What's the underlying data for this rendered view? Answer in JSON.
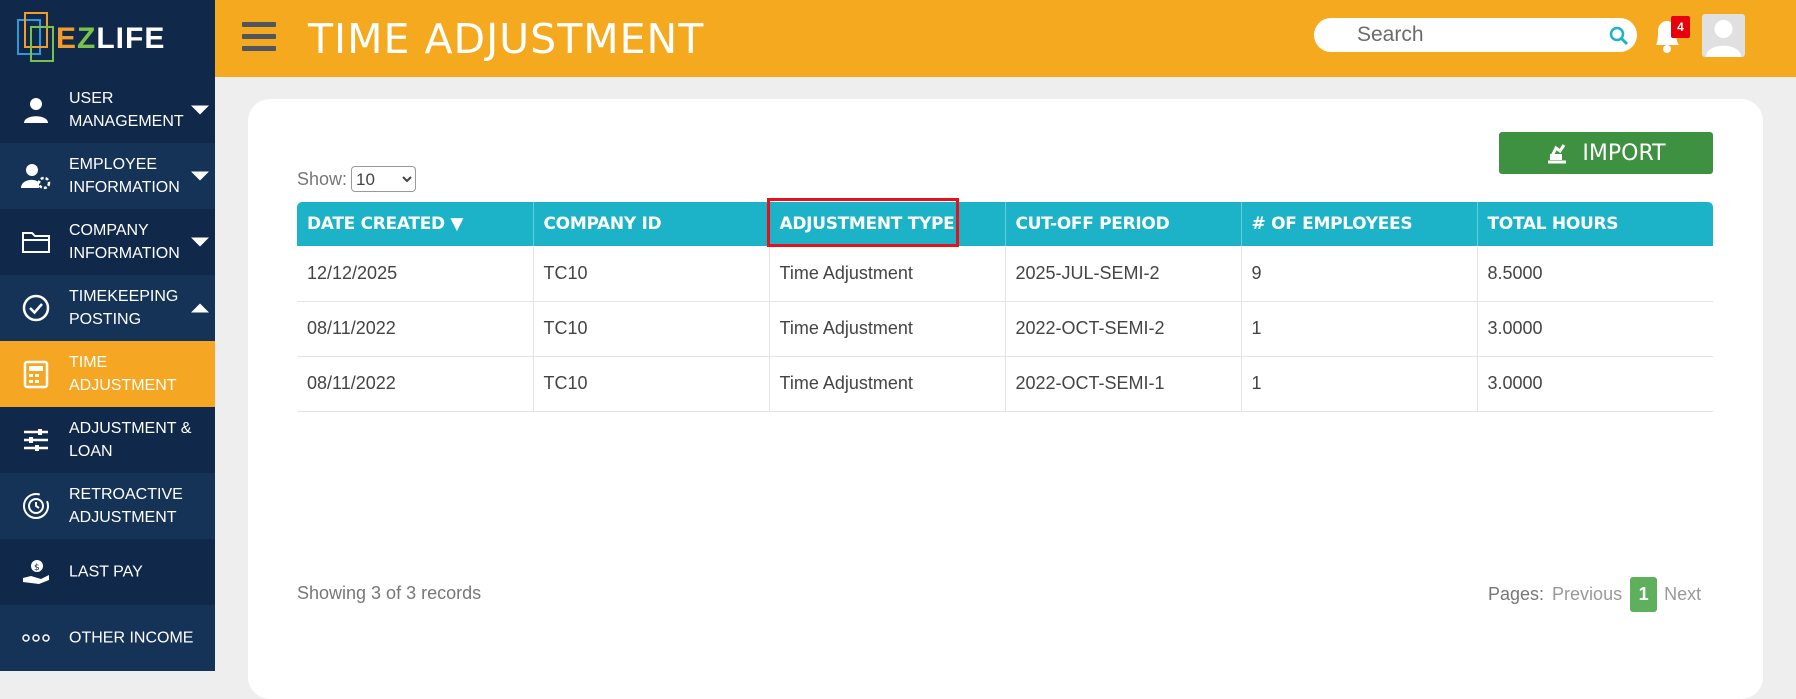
{
  "brand": {
    "name_e": "E",
    "name_z": "Z",
    "name_rest": "LIFE"
  },
  "sidebar": {
    "items": [
      {
        "label": "USER MANAGEMENT",
        "icon": "user-icon",
        "caret": "down"
      },
      {
        "label": "EMPLOYEE INFORMATION",
        "icon": "employee-gear-icon",
        "caret": "down"
      },
      {
        "label": "COMPANY INFORMATION",
        "icon": "folder-icon",
        "caret": "down"
      },
      {
        "label": "TIMEKEEPING POSTING",
        "icon": "check-circle-icon",
        "caret": "up"
      },
      {
        "label": "TIME ADJUSTMENT",
        "icon": "calculator-icon",
        "active": true
      },
      {
        "label": "ADJUSTMENT & LOAN",
        "icon": "sliders-icon"
      },
      {
        "label": "RETROACTIVE ADJUSTMENT",
        "icon": "clock-refresh-icon"
      },
      {
        "label": "LAST PAY",
        "icon": "money-hand-icon"
      },
      {
        "label": "OTHER INCOME",
        "icon": "dots-icon"
      }
    ]
  },
  "header": {
    "title": "TIME ADJUSTMENT",
    "search_placeholder": "Search",
    "notification_count": "4"
  },
  "toolbar": {
    "import_label": "IMPORT"
  },
  "show": {
    "label": "Show:",
    "selected": "10"
  },
  "table": {
    "columns": [
      "DATE CREATED ▼",
      "COMPANY ID",
      "ADJUSTMENT TYPE",
      "CUT-OFF PERIOD",
      "# OF EMPLOYEES",
      "TOTAL HOURS"
    ],
    "rows": [
      [
        "12/12/2025",
        "TC10",
        "Time Adjustment",
        "2025-JUL-SEMI-2",
        "9",
        "8.5000"
      ],
      [
        "08/11/2022",
        "TC10",
        "Time Adjustment",
        "2022-OCT-SEMI-2",
        "1",
        "3.0000"
      ],
      [
        "08/11/2022",
        "TC10",
        "Time Adjustment",
        "2022-OCT-SEMI-1",
        "1",
        "3.0000"
      ]
    ]
  },
  "footer": {
    "records_text": "Showing 3 of 3 records",
    "pages_label": "Pages:",
    "previous": "Previous",
    "current_page": "1",
    "next": "Next"
  },
  "colors": {
    "header": "#f5a91f",
    "sidebar": "#10284a",
    "table_header": "#1cb3c9",
    "import": "#3f9142",
    "highlight": "#e8101c"
  }
}
